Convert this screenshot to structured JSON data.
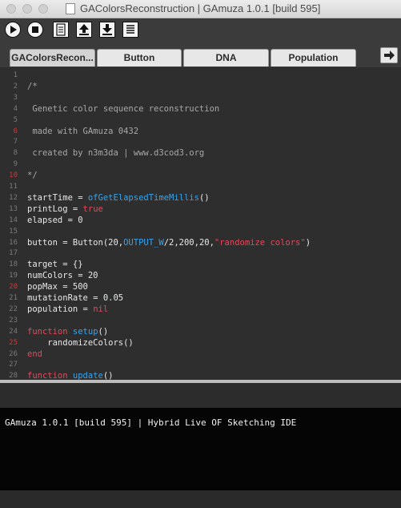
{
  "window": {
    "title": "GAColorsReconstruction | GAmuza 1.0.1 [build 595]"
  },
  "toolbar": {
    "buttons": [
      "play-icon",
      "stop-icon",
      "new-file-icon",
      "upload-icon",
      "download-icon",
      "list-icon"
    ]
  },
  "tabs": [
    {
      "label": "GAColorsRecon...",
      "active": true
    },
    {
      "label": "Button",
      "active": false
    },
    {
      "label": "DNA",
      "active": false
    },
    {
      "label": "Population",
      "active": false
    }
  ],
  "editor": {
    "lines": [
      {
        "n": "1",
        "err": false,
        "toks": []
      },
      {
        "n": "2",
        "err": false,
        "toks": [
          [
            "cm",
            "/*"
          ]
        ]
      },
      {
        "n": "3",
        "err": false,
        "toks": []
      },
      {
        "n": "4",
        "err": false,
        "toks": [
          [
            "cm",
            " Genetic color sequence reconstruction"
          ]
        ]
      },
      {
        "n": "5",
        "err": false,
        "toks": []
      },
      {
        "n": "6",
        "err": true,
        "toks": [
          [
            "cm",
            " made with GAmuza 0432"
          ]
        ]
      },
      {
        "n": "7",
        "err": false,
        "toks": []
      },
      {
        "n": "8",
        "err": false,
        "toks": [
          [
            "cm",
            " created by n3m3da | www.d3cod3.org"
          ]
        ]
      },
      {
        "n": "9",
        "err": false,
        "toks": []
      },
      {
        "n": "10",
        "err": true,
        "toks": [
          [
            "cm",
            "*/"
          ]
        ]
      },
      {
        "n": "11",
        "err": false,
        "toks": []
      },
      {
        "n": "12",
        "err": false,
        "toks": [
          [
            "tx",
            "startTime = "
          ],
          [
            "fn",
            "ofGetElapsedTimeMillis"
          ],
          [
            "tx",
            "()"
          ]
        ]
      },
      {
        "n": "13",
        "err": false,
        "toks": [
          [
            "tx",
            "printLog = "
          ],
          [
            "kw",
            "true"
          ]
        ]
      },
      {
        "n": "14",
        "err": false,
        "toks": [
          [
            "tx",
            "elapsed = 0"
          ]
        ]
      },
      {
        "n": "15",
        "err": false,
        "toks": []
      },
      {
        "n": "16",
        "err": false,
        "toks": [
          [
            "tx",
            "button = Button(20,"
          ],
          [
            "fn",
            "OUTPUT_W"
          ],
          [
            "tx",
            "/2,200,20,"
          ],
          [
            "st",
            "\"randomize colors\""
          ],
          [
            "tx",
            ")"
          ]
        ]
      },
      {
        "n": "17",
        "err": false,
        "toks": []
      },
      {
        "n": "18",
        "err": false,
        "toks": [
          [
            "tx",
            "target = {}"
          ]
        ]
      },
      {
        "n": "19",
        "err": false,
        "toks": [
          [
            "tx",
            "numColors = 20"
          ]
        ]
      },
      {
        "n": "20",
        "err": true,
        "toks": [
          [
            "tx",
            "popMax = 500"
          ]
        ]
      },
      {
        "n": "21",
        "err": false,
        "toks": [
          [
            "tx",
            "mutationRate = 0.05"
          ]
        ]
      },
      {
        "n": "22",
        "err": false,
        "toks": [
          [
            "tx",
            "population = "
          ],
          [
            "kw",
            "nil"
          ]
        ]
      },
      {
        "n": "23",
        "err": false,
        "toks": []
      },
      {
        "n": "24",
        "err": false,
        "toks": [
          [
            "kw",
            "function "
          ],
          [
            "fn",
            "setup"
          ],
          [
            "tx",
            "()"
          ]
        ]
      },
      {
        "n": "25",
        "err": true,
        "toks": [
          [
            "tx",
            "    randomizeColors()"
          ]
        ]
      },
      {
        "n": "26",
        "err": false,
        "toks": [
          [
            "kw",
            "end"
          ]
        ]
      },
      {
        "n": "27",
        "err": false,
        "toks": []
      },
      {
        "n": "28",
        "err": false,
        "toks": [
          [
            "kw",
            "function "
          ],
          [
            "fn",
            "update"
          ],
          [
            "tx",
            "()"
          ]
        ]
      }
    ]
  },
  "console": {
    "text": "GAmuza 1.0.1 [build 595] | Hybrid Live OF Sketching IDE"
  },
  "colors": {
    "comment": "#a8a8a8",
    "keyword": "#e8475a",
    "function": "#3aa2e8",
    "string": "#e8475a",
    "text": "#e8e8e8",
    "editor_bg": "#2e2e2e",
    "console_bg": "#050505"
  }
}
